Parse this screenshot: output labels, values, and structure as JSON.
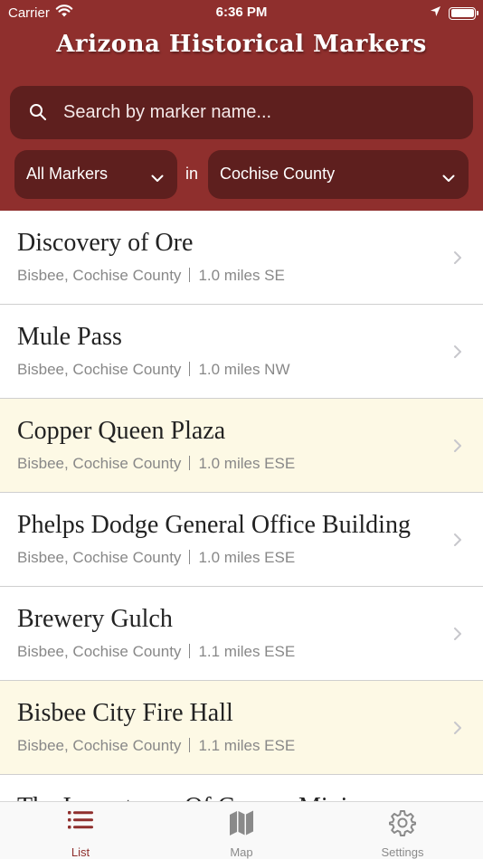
{
  "status_bar": {
    "carrier": "Carrier",
    "time": "6:36 PM",
    "battery_level": 1.0
  },
  "header": {
    "title": "Arizona Historical Markers",
    "color": "#8f2f2d",
    "control_color": "#5e1f1e"
  },
  "search": {
    "placeholder": "Search by marker name...",
    "value": "",
    "icon": "search-icon"
  },
  "filters": {
    "type_selected": "All Markers",
    "connector": "in",
    "county_selected": "Cochise County"
  },
  "markers": [
    {
      "name": "Discovery of Ore",
      "location": "Bisbee, Cochise County",
      "distance": "1.0 miles SE",
      "highlighted": false
    },
    {
      "name": "Mule Pass",
      "location": "Bisbee, Cochise County",
      "distance": "1.0 miles NW",
      "highlighted": false
    },
    {
      "name": "Copper Queen Plaza",
      "location": "Bisbee, Cochise County",
      "distance": "1.0 miles ESE",
      "highlighted": true
    },
    {
      "name": "Phelps Dodge General Office Building",
      "location": "Bisbee, Cochise County",
      "distance": "1.0 miles ESE",
      "highlighted": false
    },
    {
      "name": "Brewery Gulch",
      "location": "Bisbee, Cochise County",
      "distance": "1.1 miles ESE",
      "highlighted": false
    },
    {
      "name": "Bisbee City Fire Hall",
      "location": "Bisbee, Cochise County",
      "distance": "1.1 miles ESE",
      "highlighted": true
    },
    {
      "name": "The Importance Of Copper Mining",
      "location": "",
      "distance": "",
      "highlighted": false
    }
  ],
  "highlight_color": "#fdf9e5",
  "tabs": [
    {
      "label": "List",
      "icon": "list-icon",
      "active": true
    },
    {
      "label": "Map",
      "icon": "map-icon",
      "active": false
    },
    {
      "label": "Settings",
      "icon": "gear-icon",
      "active": false
    }
  ]
}
